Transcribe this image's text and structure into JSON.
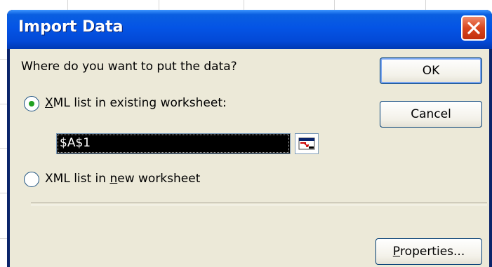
{
  "dialog": {
    "title": "Import Data",
    "prompt": "Where do you want to put the data?",
    "options": [
      {
        "label_before": "",
        "mnemonic": "X",
        "label_after": "ML list in existing worksheet:",
        "checked": true
      },
      {
        "label_before": "XML list in ",
        "mnemonic": "n",
        "label_after": "ew worksheet",
        "checked": false
      }
    ],
    "range_value": "$A$1",
    "ok_label": "OK",
    "cancel_label": "Cancel",
    "properties_mnemonic": "P",
    "properties_rest": "roperties...",
    "icons": {
      "close": "close-icon",
      "range": "collapse-dialog-icon"
    }
  },
  "colors": {
    "titlebar": "#0454e5",
    "client": "#ece9d8",
    "close": "#d9461e",
    "radio_dot": "#21a121"
  }
}
